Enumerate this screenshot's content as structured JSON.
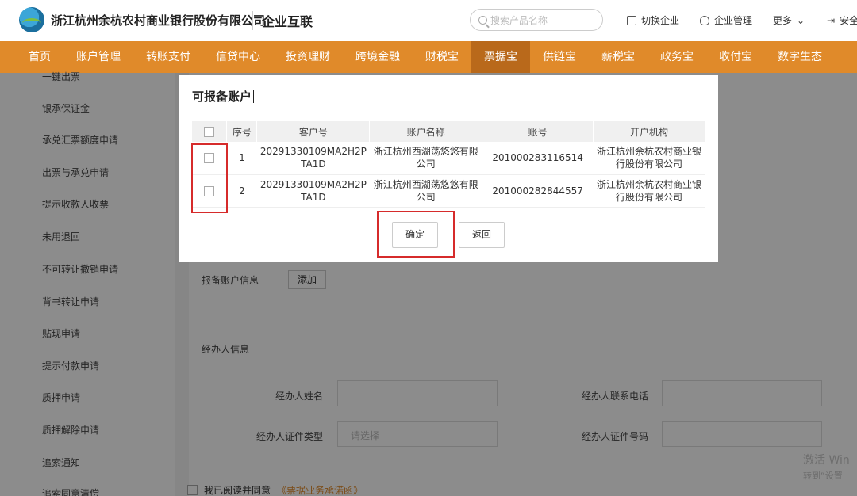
{
  "header": {
    "bank_name": "浙江杭州余杭农村商业银行股份有限公司",
    "sub_brand": "企业互联",
    "search_placeholder": "搜索产品名称",
    "switch_company": "切换企业",
    "company_manage": "企业管理",
    "more": "更多",
    "safe_exit": "安全"
  },
  "nav": {
    "items": [
      "首页",
      "账户管理",
      "转账支付",
      "信贷中心",
      "投资理财",
      "跨境金融",
      "财税宝",
      "票据宝",
      "供链宝",
      "薪税宝",
      "政务宝",
      "收付宝",
      "数字生态"
    ],
    "active_index": 7
  },
  "sidebar": {
    "items": [
      "一键出票",
      "银承保证金",
      "承兑汇票额度申请",
      "出票与承兑申请",
      "提示收款人收票",
      "未用退回",
      "不可转让撤销申请",
      "背书转让申请",
      "贴现申请",
      "提示付款申请",
      "质押申请",
      "质押解除申请",
      "追索通知",
      "追索同意清偿"
    ]
  },
  "form": {
    "report_account_label": "报备账户信息",
    "add_button": "添加",
    "agent_info_title": "经办人信息",
    "agent_name_label": "经办人姓名",
    "agent_phone_label": "经办人联系电话",
    "agent_id_type_label": "经办人证件类型",
    "agent_id_type_placeholder": "请选择",
    "agent_id_number_label": "经办人证件号码",
    "agree_text": "我已阅读并同意",
    "agree_link": "《票据业务承诺函》"
  },
  "modal": {
    "title": "可报备账户",
    "columns": [
      "序号",
      "客户号",
      "账户名称",
      "账号",
      "开户机构"
    ],
    "rows": [
      {
        "index": "1",
        "customer_no": "20291330109MA2H2PTA1D",
        "account_name": "浙江杭州西湖荡悠悠有限公司",
        "account_no": "201000283116514",
        "branch": "浙江杭州余杭农村商业银行股份有限公司"
      },
      {
        "index": "2",
        "customer_no": "20291330109MA2H2PTA1D",
        "account_name": "浙江杭州西湖荡悠悠有限公司",
        "account_no": "201000282844557",
        "branch": "浙江杭州余杭农村商业银行股份有限公司"
      }
    ],
    "confirm_button": "确定",
    "back_button": "返回"
  },
  "watermark": {
    "line1": "激活 Win",
    "line2": "转到“设置"
  },
  "colors": {
    "nav_bg": "#e08a2a",
    "nav_active": "#b9691b",
    "highlight_red": "#d62b2b"
  }
}
